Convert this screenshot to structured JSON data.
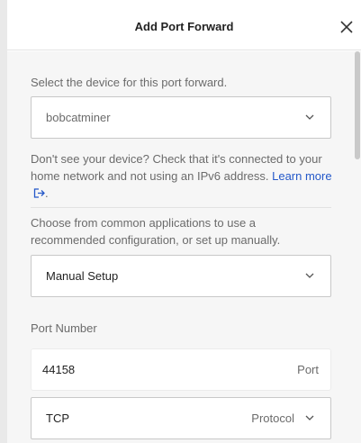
{
  "dialog": {
    "title": "Add Port Forward"
  },
  "device": {
    "label": "Select the device for this port forward.",
    "selected": "bobcatminer"
  },
  "help": {
    "text": "Don't see your device? Check that it's connected to your home network and not using an IPv6 address. ",
    "link_text": "Learn more",
    "after_link": "."
  },
  "application": {
    "label": "Choose from common applications to use a recommended configuration, or set up manually.",
    "selected": "Manual Setup"
  },
  "port": {
    "label": "Port Number",
    "value": "44158",
    "suffix": "Port"
  },
  "protocol": {
    "value": "TCP",
    "label": "Protocol"
  },
  "icons": {
    "close": "close-icon",
    "chevron": "chevron-down-icon",
    "external_link": "external-link-icon"
  },
  "colors": {
    "link": "#2458c9",
    "body_bg": "#f6f6f6",
    "muted_text": "#6b6b6b"
  }
}
